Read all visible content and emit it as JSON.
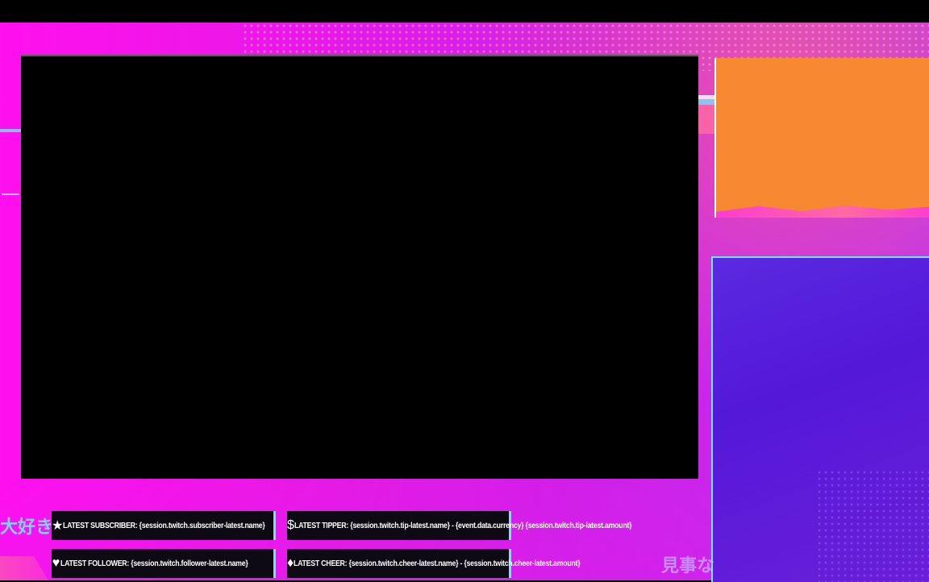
{
  "overlay": {
    "deco_text_left": "大好き",
    "deco_text_right": "見事な"
  },
  "alerts": {
    "subscriber": {
      "icon": "star-icon",
      "text": "LATEST SUBSCRIBER: {session.twitch.subscriber-latest.name}"
    },
    "follower": {
      "icon": "heart-icon",
      "text": "LATEST FOLLOWER: {session.twitch.follower-latest.name}"
    },
    "tipper": {
      "icon": "dollar-icon",
      "text": "LATEST TIPPER: {session.twitch.tip-latest.name} - {event.data.currency} {session.twitch.tip-latest.amount}"
    },
    "cheer": {
      "icon": "diamond-icon",
      "text": "LATEST CHEER: {session.twitch.cheer-latest.name} - {session.twitch.cheer-latest.amount}"
    }
  },
  "colors": {
    "accent": "#6fe6ff",
    "magenta": "#ff10ee",
    "webcam": "#f58830",
    "chat": "#5a2ae0"
  }
}
